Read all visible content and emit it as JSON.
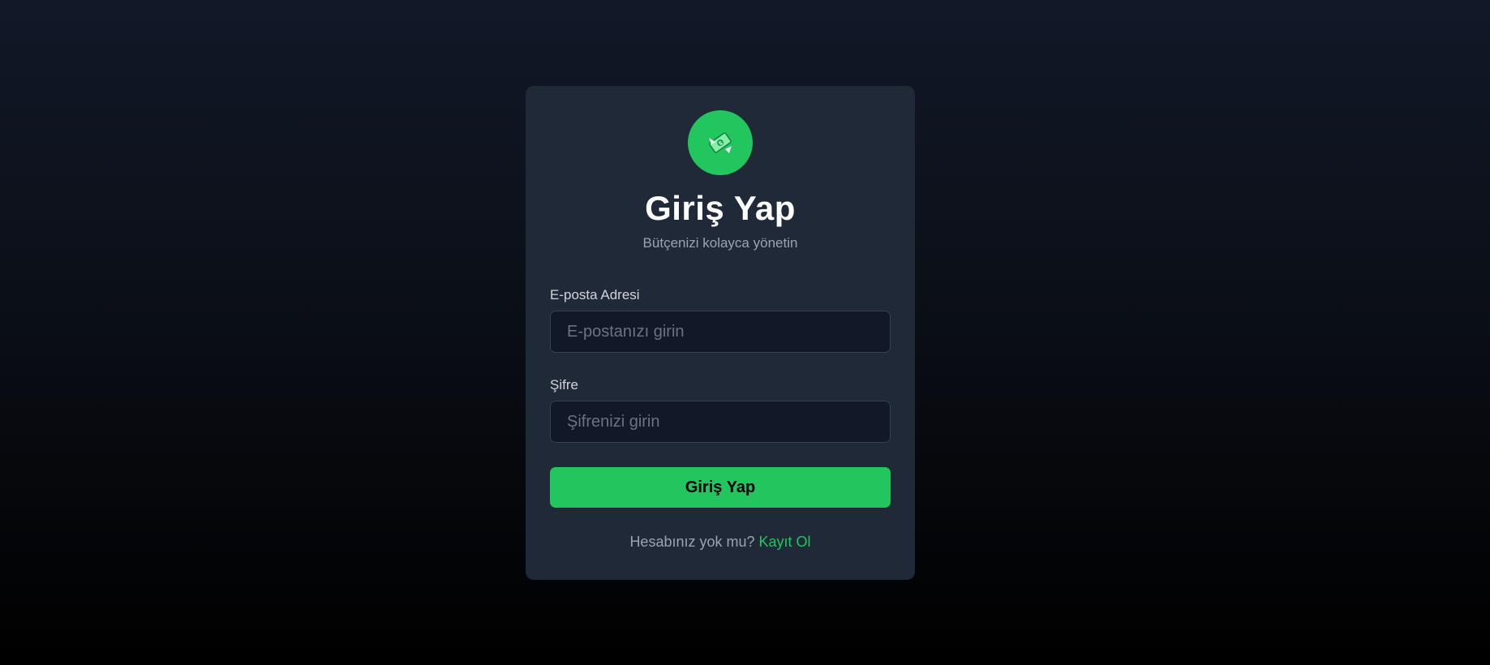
{
  "app": {
    "logo_icon": "money-with-wings-icon",
    "accent_color": "#22c55e"
  },
  "header": {
    "title": "Giriş Yap",
    "subtitle": "Bütçenizi kolayca yönetin"
  },
  "form": {
    "email": {
      "label": "E-posta Adresi",
      "placeholder": "E-postanızı girin",
      "value": ""
    },
    "password": {
      "label": "Şifre",
      "placeholder": "Şifrenizi girin",
      "value": ""
    },
    "submit_label": "Giriş Yap"
  },
  "footer": {
    "prompt": "Hesabınız yok mu?",
    "register_link": "Kayıt Ol"
  }
}
